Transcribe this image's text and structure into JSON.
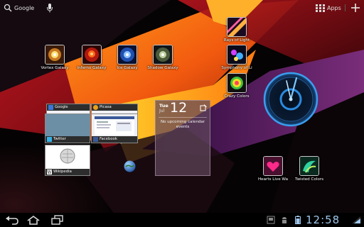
{
  "topbar": {
    "search_label": "Google",
    "apps_label": "Apps"
  },
  "shortcuts": [
    {
      "label": "Vortex Galaxy"
    },
    {
      "label": "Inferno Galaxy"
    },
    {
      "label": "Ice Galaxy"
    },
    {
      "label": "Shadow Galaxy"
    },
    {
      "label": "Rays of Light"
    },
    {
      "label": "Symphony of Li"
    },
    {
      "label": "Crazy Colors"
    },
    {
      "label": "Hearts Live Wa"
    },
    {
      "label": "Twisted Colors"
    }
  ],
  "social_widget": {
    "cards": [
      {
        "label": "Google"
      },
      {
        "label": "Picasa"
      },
      {
        "label": "Twitter"
      },
      {
        "label": "Facebook"
      },
      {
        "label": "Wikipedia"
      }
    ]
  },
  "calendar": {
    "day_of_week": "Tue",
    "month": "Jul",
    "day": "12",
    "message": "No upcoming calendar events"
  },
  "statusbar": {
    "time": "12:58"
  },
  "icons": {
    "search": "search-icon",
    "voice": "microphone-icon",
    "apps": "apps-grid-icon",
    "add": "plus-icon",
    "back": "back-arrow-icon",
    "home": "home-icon",
    "recents": "recent-apps-icon"
  }
}
